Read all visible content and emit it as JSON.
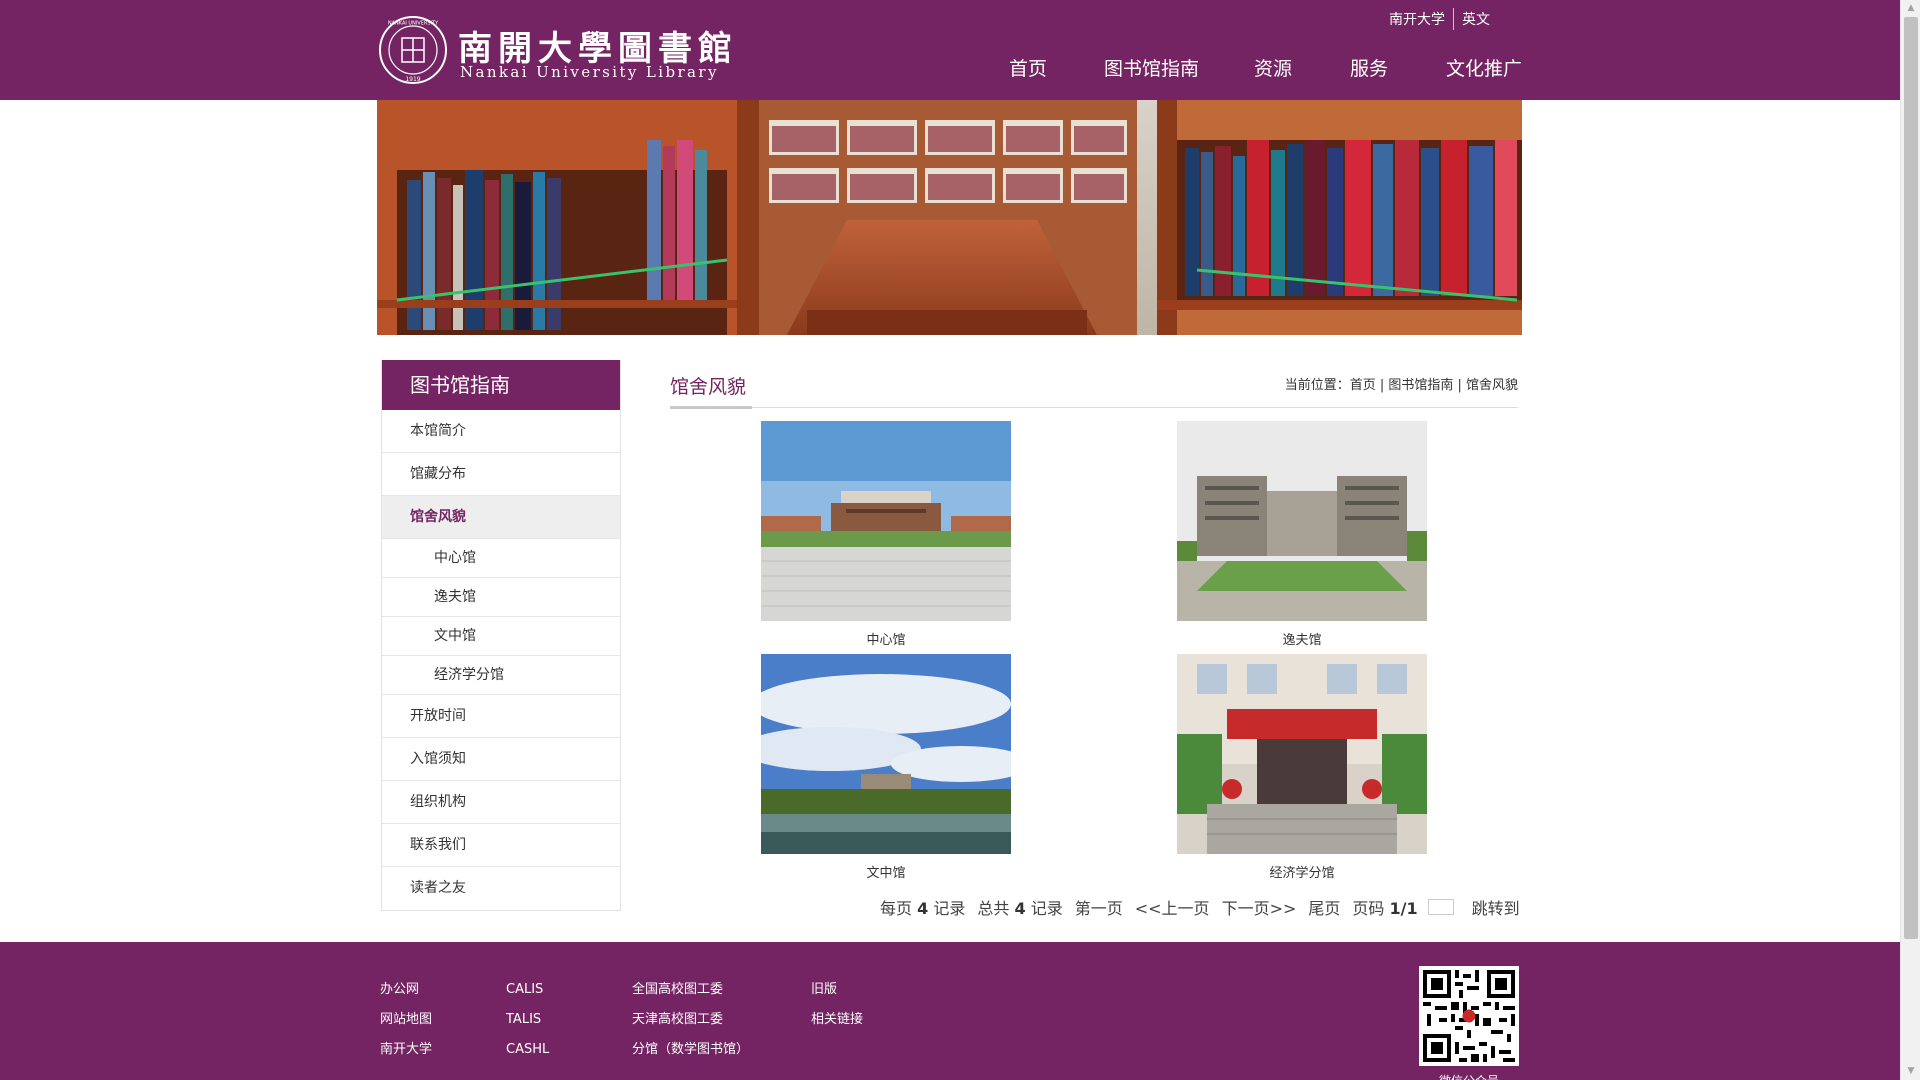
{
  "header": {
    "logo_cn": "南開大學圖書館",
    "logo_en": "Nankai University Library",
    "seal_text": "NANKAI UNIVERSITY",
    "seal_year": "1919",
    "top_links": [
      "南开大学",
      "英文"
    ],
    "nav": [
      "首页",
      "图书馆指南",
      "资源",
      "服务",
      "文化推广"
    ],
    "brand_color": "#742463"
  },
  "sidebar": {
    "title": "图书馆指南",
    "items": [
      {
        "label": "本馆简介"
      },
      {
        "label": "馆藏分布"
      },
      {
        "label": "馆舍风貌",
        "active": true
      },
      {
        "label": "中心馆",
        "sub": true
      },
      {
        "label": "逸夫馆",
        "sub": true
      },
      {
        "label": "文中馆",
        "sub": true
      },
      {
        "label": "经济学分馆",
        "sub": true
      },
      {
        "label": "开放时间"
      },
      {
        "label": "入馆须知"
      },
      {
        "label": "组织机构"
      },
      {
        "label": "联系我们"
      },
      {
        "label": "读者之友"
      }
    ]
  },
  "content": {
    "title": "馆舍风貌",
    "breadcrumb_prefix": "当前位置：",
    "breadcrumb": "首页 | 图书馆指南 | 馆舍风貌",
    "photos": [
      {
        "caption": "中心馆"
      },
      {
        "caption": "逸夫馆"
      },
      {
        "caption": "文中馆"
      },
      {
        "caption": "经济学分馆"
      }
    ]
  },
  "pager": {
    "per_page_prefix": "每页",
    "per_page": "4",
    "per_page_suffix": "记录",
    "total_prefix": "总共",
    "total": "4",
    "total_suffix": "记录",
    "first": "第一页",
    "prev": "<<上一页",
    "next": "下一页>>",
    "last": "尾页",
    "page_prefix": "页码",
    "page": "1/1",
    "jump": "跳转到"
  },
  "footer": {
    "col1": [
      "办公网",
      "网站地图",
      "南开大学"
    ],
    "col2": [
      "CALIS",
      "TALIS",
      "CASHL"
    ],
    "col3": [
      "全国高校图工委",
      "天津高校图工委",
      "分馆（数学图书馆）"
    ],
    "col4": [
      "旧版",
      "相关链接"
    ],
    "qr_caption": "微信公众号"
  }
}
